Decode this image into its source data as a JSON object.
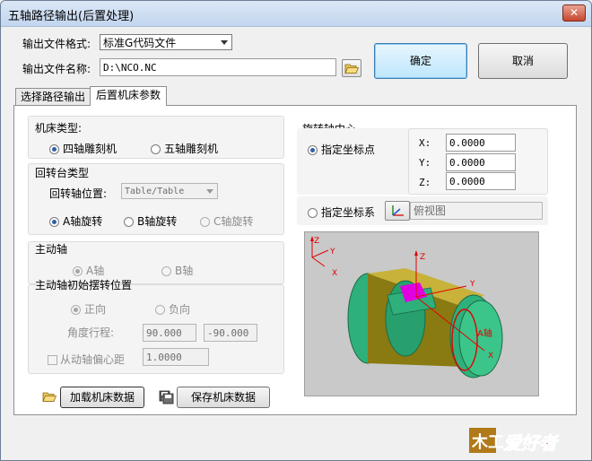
{
  "window": {
    "title": "五轴路径输出(后置处理)",
    "close_glyph": "✕"
  },
  "output": {
    "format_label": "输出文件格式:",
    "format_value": "标准G代码文件",
    "name_label": "输出文件名称:",
    "name_value": "D:\\NCO.NC"
  },
  "buttons": {
    "ok": "确定",
    "cancel": "取消",
    "load": "加载机床数据",
    "save": "保存机床数据"
  },
  "tabs": [
    {
      "label": "选择路径输出"
    },
    {
      "label": "后置机床参数"
    }
  ],
  "machine_type": {
    "title": "机床类型:",
    "options": [
      "四轴雕刻机",
      "五轴雕刻机"
    ],
    "selected": "四轴雕刻机"
  },
  "rotary_table": {
    "title": "回转台类型",
    "axis_position_label": "回转轴位置:",
    "axis_position_value": "Table/Table",
    "options": [
      "A轴旋转",
      "B轴旋转",
      "C轴旋转"
    ],
    "selected": "A轴旋转"
  },
  "master_axis": {
    "title": "主动轴",
    "options": [
      "A轴",
      "B轴"
    ],
    "selected": "A轴"
  },
  "initial_rotation": {
    "title": "主动轴初始摆转位置",
    "options": [
      "正向",
      "负向"
    ],
    "selected": "正向",
    "angle_label": "角度行程:",
    "angle_min": "90.000",
    "angle_max": "-90.000",
    "offset_label": "从动轴偏心距",
    "offset_value": "1.0000"
  },
  "rotation_center": {
    "title": "旋转轴中心",
    "option_point": "指定坐标点",
    "x_label": "X:",
    "x_value": "0.0000",
    "y_label": "Y:",
    "y_value": "0.0000",
    "z_label": "Z:",
    "z_value": "0.0000",
    "option_system": "指定坐标系",
    "system_value": "俯视图",
    "selected": "指定坐标点"
  },
  "preview": {
    "axis_z": "Z",
    "axis_y": "Y",
    "axis_x": "X",
    "part_z": "Z",
    "part_y": "Y",
    "part_x": "X",
    "a_axis": "A轴"
  },
  "watermark": {
    "text": "爱好者"
  },
  "colors": {
    "part_green": "#2fb07a",
    "part_gold": "#8a7a12",
    "magenta": "#e000e0",
    "axis_red": "#e00000"
  }
}
